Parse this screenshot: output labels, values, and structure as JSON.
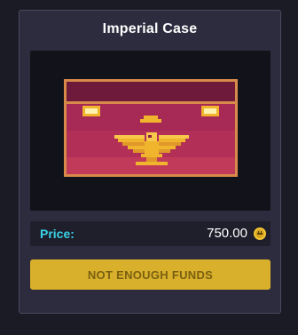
{
  "case": {
    "title": "Imperial Case",
    "image_icon": "imperial-eagle-case"
  },
  "price": {
    "label": "Price:",
    "value": "750.00",
    "currency_icon": "coin-icon"
  },
  "action": {
    "button_label": "NOT ENOUGH FUNDS",
    "enabled": false
  },
  "colors": {
    "accent_cyan": "#3ad2e6",
    "button_gold": "#d9b02c",
    "case_crimson": "#9a2a52",
    "eagle_gold": "#f0b52c"
  }
}
